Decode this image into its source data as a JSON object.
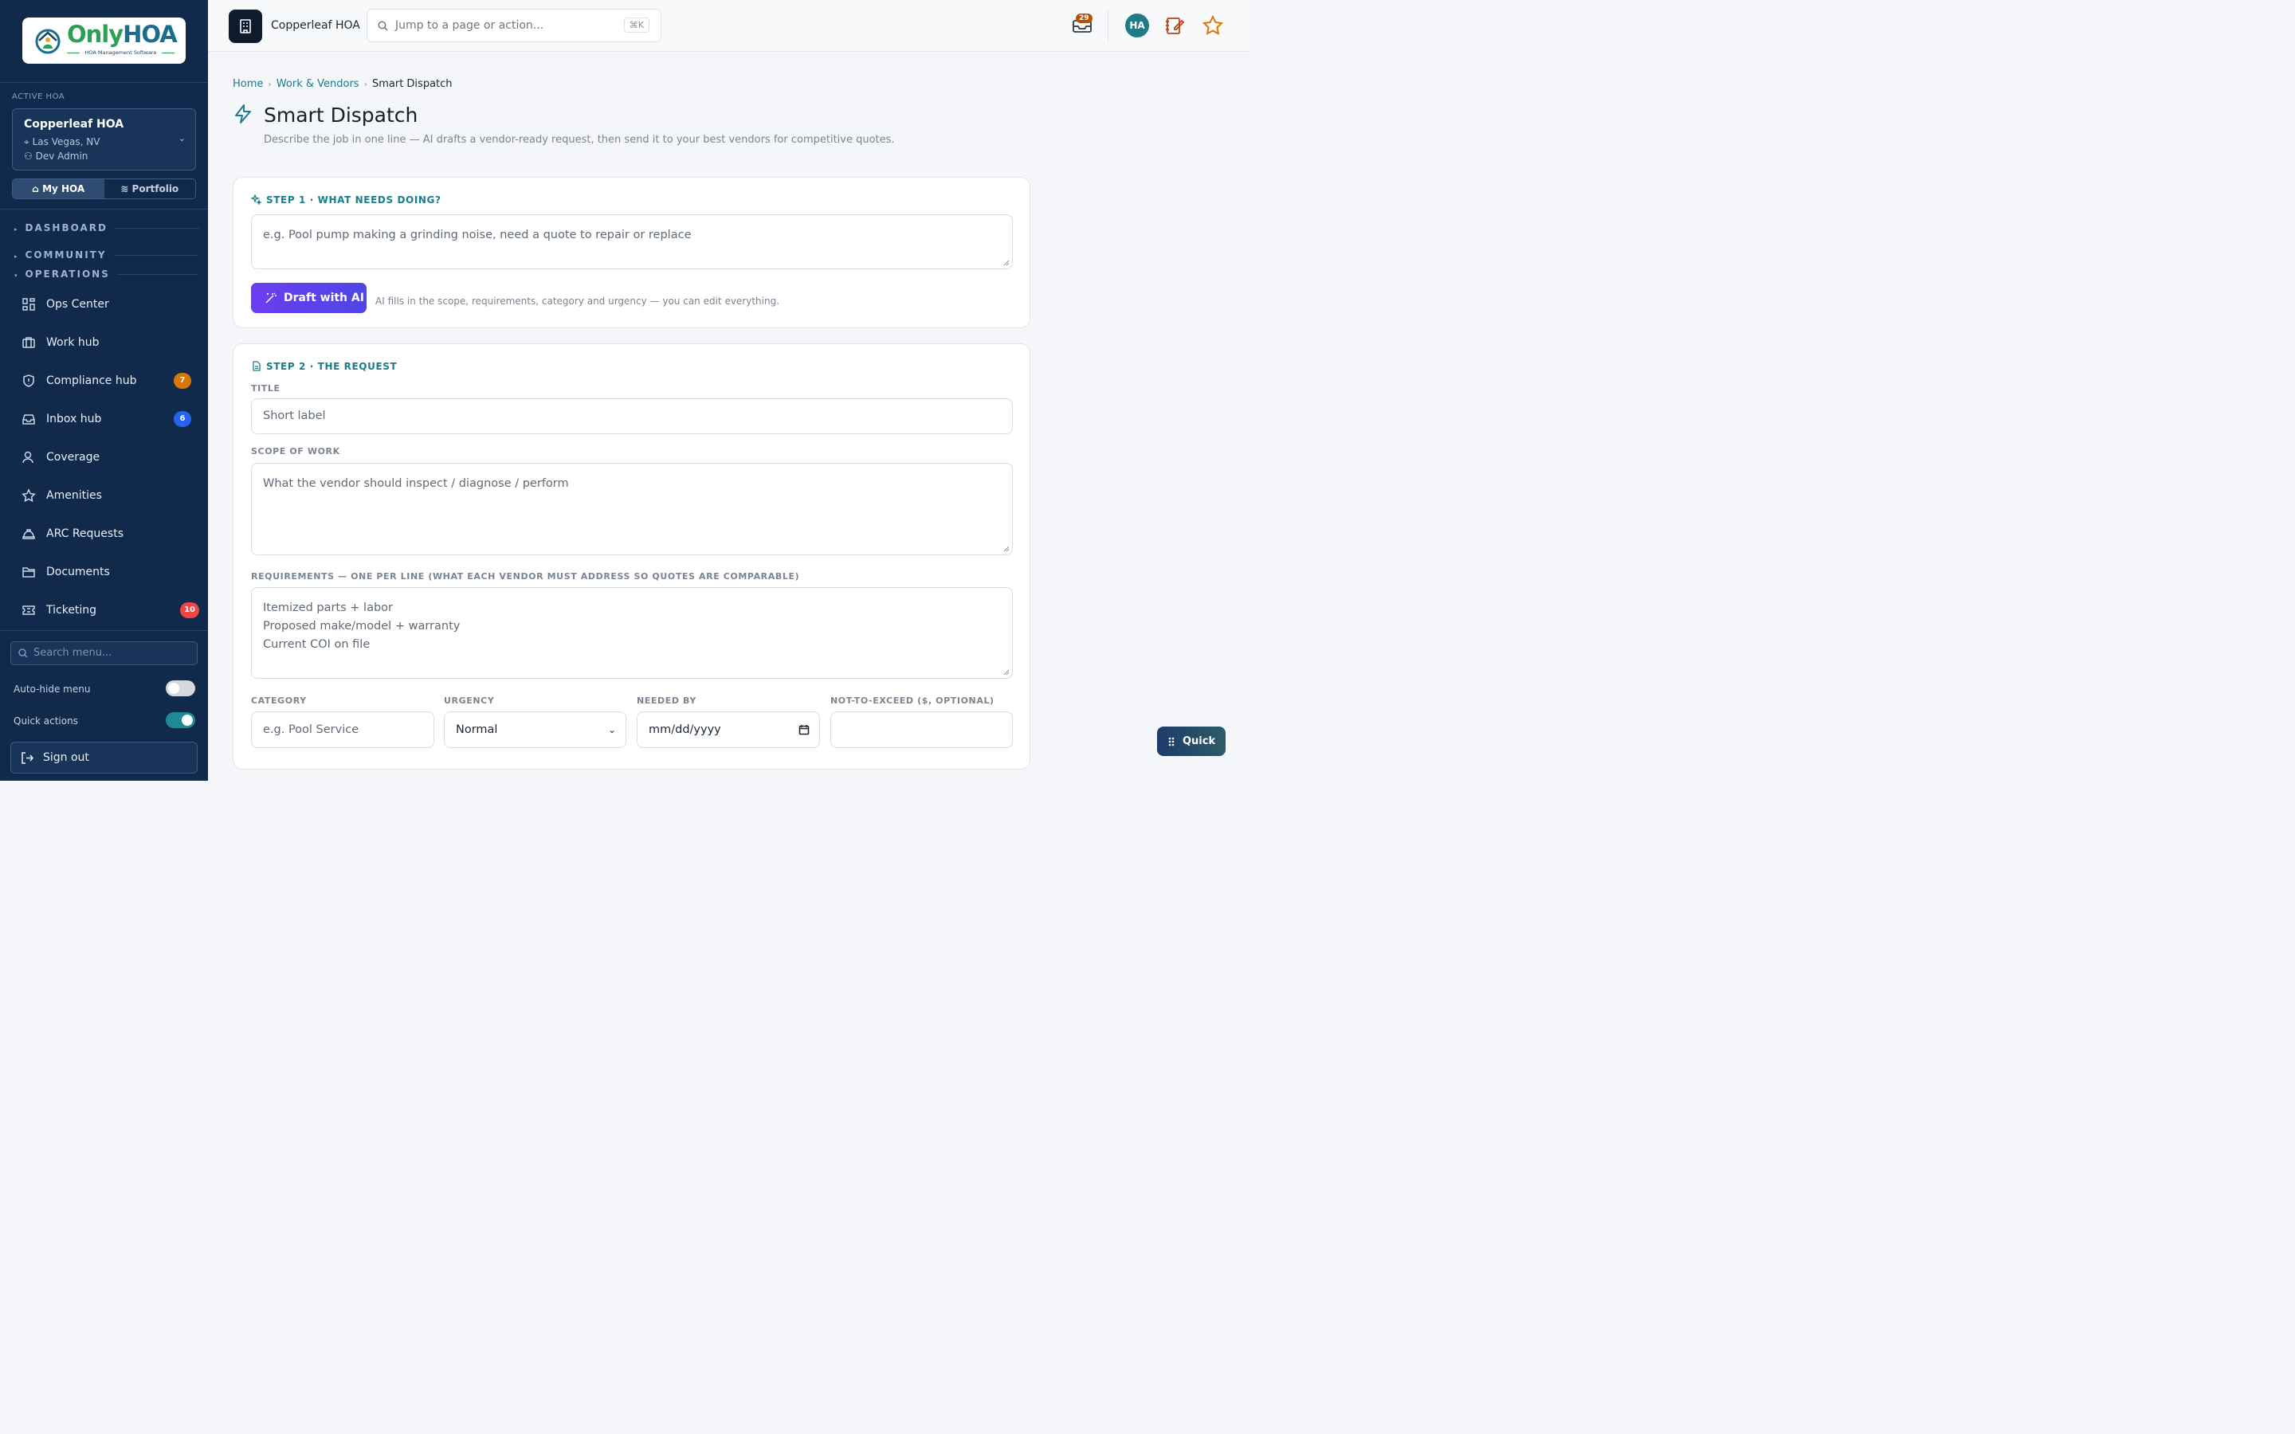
{
  "brand": {
    "logo_only": "Only",
    "logo_hoa": "HOA",
    "logo_tagline": "HOA Management Software"
  },
  "sidebar": {
    "active_label": "ACTIVE HOA",
    "hoa_name": "Copperleaf HOA",
    "hoa_location": "Las Vegas, NV",
    "hoa_user": "Dev Admin",
    "seg_my": "My HOA",
    "seg_portfolio": "Portfolio",
    "sections": {
      "dashboard": "DASHBOARD",
      "community": "COMMUNITY",
      "operations": "OPERATIONS"
    },
    "items": [
      {
        "label": "Ops Center",
        "icon": "grid-icon",
        "badge": ""
      },
      {
        "label": "Work hub",
        "icon": "briefcase-icon",
        "badge": ""
      },
      {
        "label": "Compliance hub",
        "icon": "shield-icon",
        "badge": "7",
        "badge_color": "#d97706"
      },
      {
        "label": "Inbox hub",
        "icon": "inbox-icon",
        "badge": "6",
        "badge_color": "#2563eb"
      },
      {
        "label": "Coverage",
        "icon": "user-icon",
        "badge": ""
      },
      {
        "label": "Amenities",
        "icon": "star-icon",
        "badge": ""
      },
      {
        "label": "ARC Requests",
        "icon": "hard-hat-icon",
        "badge": ""
      },
      {
        "label": "Documents",
        "icon": "folder-icon",
        "badge": ""
      },
      {
        "label": "Ticketing",
        "icon": "ticket-icon",
        "badge": "10",
        "badge_color": "#ef4444"
      }
    ],
    "search_placeholder": "Search menu...",
    "auto_hide_label": "Auto-hide menu",
    "auto_hide_on": false,
    "quick_actions_label": "Quick actions",
    "quick_actions_on": true,
    "sign_out": "Sign out"
  },
  "topbar": {
    "org_name": "Copperleaf HOA",
    "jump_placeholder": "Jump to a page or action...",
    "jump_shortcut": "⌘K",
    "inbox_count": "29",
    "avatar_initials": "HA"
  },
  "main": {
    "breadcrumb": [
      "Home",
      "Work & Vendors",
      "Smart Dispatch"
    ],
    "title": "Smart Dispatch",
    "subtitle": "Describe the job in one line — AI drafts a vendor-ready request, then send it to your best vendors for competitive quotes.",
    "step1": {
      "heading": "STEP 1 · WHAT NEEDS DOING?",
      "placeholder": "e.g. Pool pump making a grinding noise, need a quote to repair or replace",
      "button": "Draft with AI",
      "hint": "AI fills in the scope, requirements, category and urgency — you can edit everything."
    },
    "step2": {
      "heading": "STEP 2 · THE REQUEST",
      "title_label": "TITLE",
      "title_placeholder": "Short label",
      "scope_label": "SCOPE OF WORK",
      "scope_placeholder": "What the vendor should inspect / diagnose / perform",
      "req_label": "REQUIREMENTS — ONE PER LINE (WHAT EACH VENDOR MUST ADDRESS SO QUOTES ARE COMPARABLE)",
      "requirements": [
        "Itemized parts + labor",
        "Proposed make/model + warranty",
        "Current COI on file"
      ],
      "category_label": "CATEGORY",
      "category_placeholder": "e.g. Pool Service",
      "urgency_label": "URGENCY",
      "urgency_value": "Normal",
      "needed_label": "NEEDED BY",
      "needed_placeholder": "mm/dd/yyyy",
      "nte_label": "NOT-TO-EXCEED ($, OPTIONAL)",
      "nte_value": ""
    }
  },
  "quick_button": "Quick",
  "colors": {
    "sidebar_bg": "#11294a",
    "accent": "#1b7c8b",
    "ai_button": "#6b3df0",
    "warning": "#b45309"
  }
}
